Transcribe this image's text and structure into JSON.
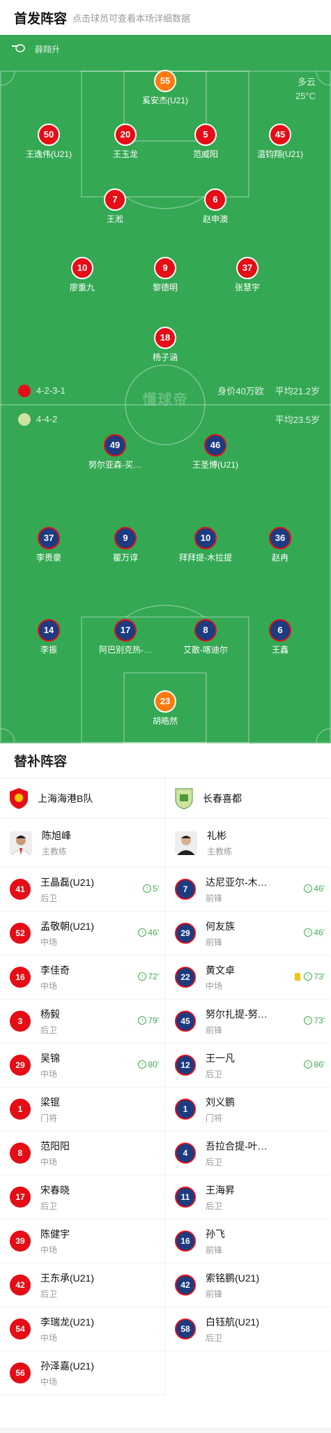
{
  "header": {
    "title": "首发阵容",
    "subtitle": "点击球员可查看本场详细数据"
  },
  "referee": {
    "name": "薛翔升",
    "icon": "whistle-icon"
  },
  "weather": {
    "condition": "多云",
    "temp": "25°C"
  },
  "watermark": "懂球帝",
  "home": {
    "name": "上海海港B队",
    "formation": "4-2-3-1",
    "value": "身价40万欧",
    "avg_age": "平均21.2岁",
    "color": "#e50d16"
  },
  "away": {
    "name": "长春喜都",
    "formation": "4-4-2",
    "avg_age": "平均23.5岁",
    "color": "#1d3b80"
  },
  "home_players": [
    {
      "num": "55",
      "name": "奚安杰(U21)",
      "gk": true
    },
    {
      "num": "50",
      "name": "王逸伟(U21)"
    },
    {
      "num": "20",
      "name": "王玉龙",
      "sub": "5'"
    },
    {
      "num": "5",
      "name": "范威阳",
      "captain": true
    },
    {
      "num": "45",
      "name": "温钧翔(U21)",
      "sub": "79'"
    },
    {
      "num": "7",
      "name": "王淞",
      "sub": "80'"
    },
    {
      "num": "6",
      "name": "赵申澳"
    },
    {
      "num": "10",
      "name": "廖重九",
      "sub": "72'"
    },
    {
      "num": "9",
      "name": "黎德明"
    },
    {
      "num": "37",
      "name": "张慧宇",
      "sub": "46'"
    },
    {
      "num": "18",
      "name": "杨子涵"
    }
  ],
  "away_players": [
    {
      "num": "49",
      "name": "努尔亚森-买…",
      "sub": "46'"
    },
    {
      "num": "46",
      "name": "王圣博(U21)",
      "sub": "73'"
    },
    {
      "num": "37",
      "name": "李贵豪"
    },
    {
      "num": "9",
      "name": "瞿万谆"
    },
    {
      "num": "10",
      "name": "拜拜提-木拉提",
      "sub": "73'",
      "yellow": true,
      "captain": true
    },
    {
      "num": "36",
      "name": "赵冉",
      "sub": "46'"
    },
    {
      "num": "14",
      "name": "李振",
      "sub": "86'"
    },
    {
      "num": "17",
      "name": "阿巴别克热-…"
    },
    {
      "num": "8",
      "name": "艾散-喀迪尔",
      "yellow": true
    },
    {
      "num": "6",
      "name": "王鑫"
    },
    {
      "num": "23",
      "name": "胡皓然",
      "gk": true
    }
  ],
  "subs": {
    "title": "替补阵容",
    "home_coach": {
      "name": "陈旭峰",
      "role": "主教练"
    },
    "away_coach": {
      "name": "礼彬",
      "role": "主教练"
    },
    "home": [
      {
        "num": "41",
        "name": "王晶磊(U21)",
        "pos": "后卫",
        "in": "5'"
      },
      {
        "num": "52",
        "name": "孟敬朝(U21)",
        "pos": "中场",
        "in": "46'"
      },
      {
        "num": "16",
        "name": "李佳奇",
        "pos": "中场",
        "in": "72'"
      },
      {
        "num": "3",
        "name": "杨毅",
        "pos": "后卫",
        "in": "79'"
      },
      {
        "num": "29",
        "name": "吴锦",
        "pos": "中场",
        "in": "80'"
      },
      {
        "num": "1",
        "name": "梁锟",
        "pos": "门将"
      },
      {
        "num": "8",
        "name": "范阳阳",
        "pos": "中场"
      },
      {
        "num": "17",
        "name": "宋春晓",
        "pos": "后卫"
      },
      {
        "num": "39",
        "name": "陈健宇",
        "pos": "中场"
      },
      {
        "num": "42",
        "name": "王东承(U21)",
        "pos": "后卫"
      },
      {
        "num": "54",
        "name": "李瑞龙(U21)",
        "pos": "中场"
      },
      {
        "num": "56",
        "name": "孙泽嘉(U21)",
        "pos": "中场"
      }
    ],
    "away": [
      {
        "num": "7",
        "name": "达尼亚尔-木…",
        "pos": "前锋",
        "in": "46'"
      },
      {
        "num": "29",
        "name": "何友族",
        "pos": "前锋",
        "in": "46'"
      },
      {
        "num": "22",
        "name": "黄文卓",
        "pos": "中场",
        "in": "73'",
        "yellow": true
      },
      {
        "num": "45",
        "name": "努尔扎提-努…",
        "pos": "前锋",
        "in": "73'"
      },
      {
        "num": "12",
        "name": "王一凡",
        "pos": "后卫",
        "in": "86'"
      },
      {
        "num": "1",
        "name": "刘义鹏",
        "pos": "门将"
      },
      {
        "num": "4",
        "name": "吾拉合提-叶…",
        "pos": "后卫"
      },
      {
        "num": "11",
        "name": "王海昇",
        "pos": "后卫"
      },
      {
        "num": "16",
        "name": "孙飞",
        "pos": "前锋"
      },
      {
        "num": "42",
        "name": "索铭�djust(U21)",
        "pos": "前锋"
      },
      {
        "num": "58",
        "name": "白钰航(U21)",
        "pos": "后卫"
      }
    ]
  }
}
